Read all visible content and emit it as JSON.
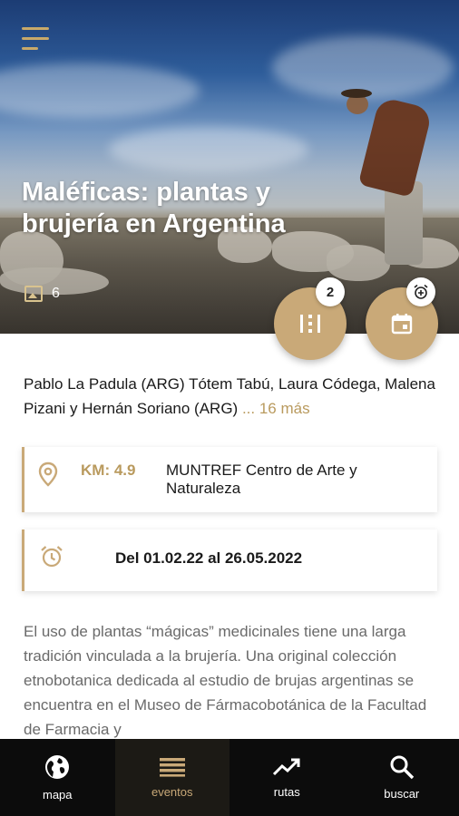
{
  "hero": {
    "title": "Maléficas: plantas y brujería en Argentina",
    "photo_count": "6",
    "icons": {
      "menu": "menu-icon",
      "photos": "image-icon"
    }
  },
  "actions": {
    "artworks_badge": "2",
    "artworks_icon": "artworks-icon",
    "calendar_icon": "calendar-icon",
    "alarm_badge_icon": "alarm-add-icon"
  },
  "artists": {
    "text": "Pablo La Padula (ARG) Tótem Tabú,  Laura Códega, Malena Pizani y Hernán  Soriano (ARG)",
    "more": "... 16 más"
  },
  "location": {
    "icon": "location-pin-icon",
    "km": "KM: 4.9",
    "venue": "MUNTREF Centro de Arte y Naturaleza"
  },
  "schedule": {
    "icon": "alarm-clock-icon",
    "dates": "Del 01.02.22 al 26.05.2022"
  },
  "description": "El uso de plantas “mágicas” medicinales tiene una larga tradición vinculada a la brujería. Una original colección etnobotanica dedicada al estudio de brujas argentinas se encuentra en el Museo de Fármacobotánica de la Facultad de Farmacia y",
  "nav": {
    "items": [
      {
        "label": "mapa",
        "icon": "globe-icon"
      },
      {
        "label": "eventos",
        "icon": "list-icon"
      },
      {
        "label": "rutas",
        "icon": "trending-icon"
      },
      {
        "label": "buscar",
        "icon": "search-icon"
      }
    ],
    "active": "eventos"
  },
  "colors": {
    "accent": "#c9a978",
    "accent_text": "#b99a5e",
    "nav_bg": "#0c0c0c"
  }
}
